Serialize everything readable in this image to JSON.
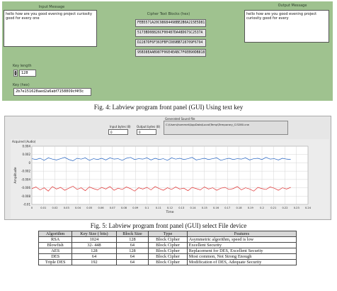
{
  "panel1": {
    "input_label": "Input Message",
    "input_text": "hello how are you good evening project curiosity good for every one",
    "cipher_label": "Cipher Text Blocks (hex)",
    "cipher_blocks": [
      "FEB5571A20C98684498BE2B0A215E5D81",
      "5173BD08826CF00487DA48D67SC2537A",
      "D2287DF6F363FBFCD89BB728709F6794",
      "95B38EAAB987F06E4EABC7F6EB90DB818"
    ],
    "output_label": "Output Message",
    "output_text": "hello how are you good evening project curiosity good for every",
    "key_length_label": "Key length",
    "key_length_value": "128",
    "key_label": "Key (hex)",
    "key_value": "2b7e151628aed2a6abf7158809cf4f3c"
  },
  "caption1": "Fig. 4: Labview program front panel (GUI) Using text key",
  "panel2": {
    "input_bytes_label": "Input bytes (8)",
    "output_bytes_label": "Output bytes (8)",
    "input_bytes_value": "0",
    "output_bytes_value": "0",
    "file_label": "Generated Sound file",
    "file_path": "C:\\Users\\hommet\\AppData\\Local\\Temp\\Temporary_Ci3280.crw"
  },
  "chart_data": {
    "type": "line",
    "title": "Acquired (Audio)",
    "xlabel": "Time",
    "ylabel": "Amplitude",
    "xlim": [
      0,
      0.24
    ],
    "ylim": [
      -0.01,
      0.004
    ],
    "x_ticks": [
      "0",
      "0.01",
      "0.02",
      "0.03",
      "0.04",
      "0.05",
      "0.06",
      "0.07",
      "0.08",
      "0.09",
      "0.1",
      "0.11",
      "0.12",
      "0.13",
      "0.14",
      "0.15",
      "0.16",
      "0.17",
      "0.18",
      "0.19",
      "0.2",
      "0.21",
      "0.22",
      "0.23",
      "0.24"
    ],
    "y_ticks": [
      "0.004",
      "0.002",
      "0",
      "-0.002",
      "-0.004",
      "-0.006",
      "-0.008",
      "-0.01"
    ],
    "grid": true,
    "series": [
      {
        "color": "#1f5fbf",
        "values": [
          0.001,
          0.0008,
          0.0011,
          0.0006,
          0.0012,
          0.0009,
          0.0007,
          0.001,
          0.0013,
          0.0008,
          0.0005,
          0.0011,
          0.0009,
          0.0012,
          0.0006,
          0.001,
          0.0008,
          0.0011,
          0.0007,
          0.0012,
          0.0009,
          0.001,
          0.0006,
          0.0011,
          0.0013,
          0.0008,
          0.001,
          0.0009,
          0.0012,
          0.0007,
          0.0011,
          0.0008,
          0.001,
          0.0006,
          0.0012,
          0.0009,
          0.0011,
          0.0008,
          0.001,
          0.0013,
          0.0007,
          0.0009,
          0.0011,
          0.0008,
          0.001,
          0.0012,
          0.0006,
          0.0009,
          0.0011,
          0.0008,
          0.001,
          0.0009,
          0.0012,
          0.0007,
          0.001,
          0.0011,
          0.0008,
          0.0013,
          0.0009,
          0.001,
          0.0007,
          0.0011,
          0.0009,
          0.0008
        ]
      },
      {
        "color": "#e03030",
        "values": [
          -0.0062,
          -0.0058,
          -0.0065,
          -0.006,
          -0.0068,
          -0.0057,
          -0.0063,
          -0.0059,
          -0.0066,
          -0.0061,
          -0.0056,
          -0.0064,
          -0.006,
          -0.0067,
          -0.0058,
          -0.0062,
          -0.0065,
          -0.0059,
          -0.0063,
          -0.0057,
          -0.0066,
          -0.0061,
          -0.0064,
          -0.0058,
          -0.0062,
          -0.0068,
          -0.006,
          -0.0063,
          -0.0059,
          -0.0065,
          -0.0057,
          -0.0062,
          -0.0066,
          -0.006,
          -0.0064,
          -0.0058,
          -0.0063,
          -0.0061,
          -0.0067,
          -0.0059,
          -0.0062,
          -0.0065,
          -0.0058,
          -0.0063,
          -0.006,
          -0.0066,
          -0.0061,
          -0.0059,
          -0.0064,
          -0.0062,
          -0.0057,
          -0.0065,
          -0.006,
          -0.0063,
          -0.0068,
          -0.0059,
          -0.0062,
          -0.0064,
          -0.0058,
          -0.0061,
          -0.0066,
          -0.006,
          -0.0063,
          -0.0059
        ]
      }
    ]
  },
  "caption2": "Fig. 5: Labview program front panel (GUI) select File device",
  "table": {
    "headers": [
      "Algorithm",
      "Key Size ( bits)",
      "Block Size",
      "Type",
      "Features"
    ],
    "rows": [
      [
        "RSA",
        "1024",
        "128",
        "Block Cipher",
        "Asymmetric algorithm, speed is low"
      ],
      [
        "Blowfish",
        "32- 448",
        "64",
        "Block Cipher",
        "Excellent Security"
      ],
      [
        "AES",
        "128",
        "128",
        "Block Cipher",
        "Replacement for DES, Excellent Security"
      ],
      [
        "DES",
        "64",
        "64",
        "Block Cipher",
        "Most common, Not Strong Enough"
      ],
      [
        "Triple DES",
        "192",
        "64",
        "Block Cipher",
        "Modification of DES, Adequate Security"
      ]
    ]
  }
}
